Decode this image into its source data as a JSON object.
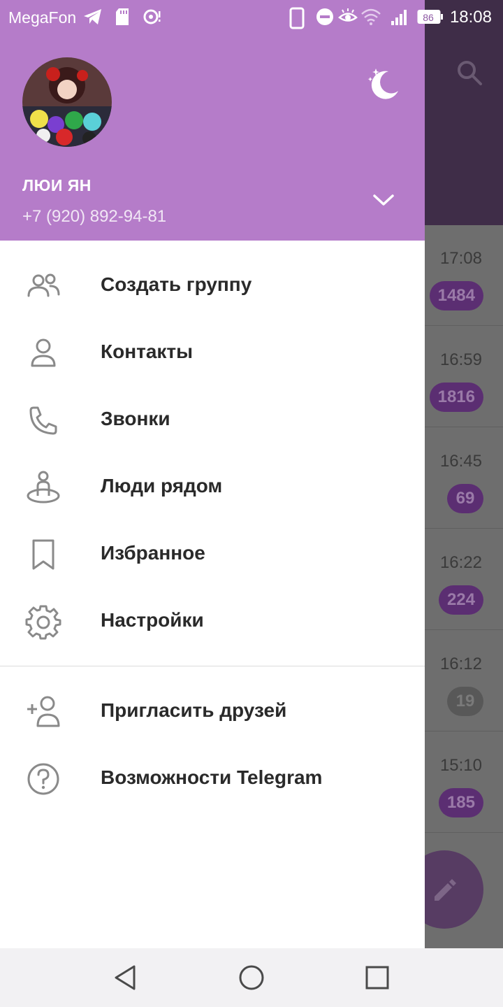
{
  "status_bar": {
    "carrier": "MegaFon",
    "battery": "86",
    "time": "18:08"
  },
  "drawer": {
    "user_name": "ЛЮИ ЯН",
    "user_phone": "+7 (920) 892-94-81",
    "menu": [
      {
        "label": "Создать группу",
        "icon": "group-icon"
      },
      {
        "label": "Контакты",
        "icon": "contact-icon"
      },
      {
        "label": "Звонки",
        "icon": "phone-icon"
      },
      {
        "label": "Люди рядом",
        "icon": "people-nearby-icon"
      },
      {
        "label": "Избранное",
        "icon": "bookmark-icon"
      },
      {
        "label": "Настройки",
        "icon": "gear-icon"
      }
    ],
    "menu_secondary": [
      {
        "label": "Пригласить друзей",
        "icon": "add-user-icon"
      },
      {
        "label": "Возможности Telegram",
        "icon": "help-icon"
      }
    ]
  },
  "chat_list": {
    "rows": [
      {
        "time": "17:08",
        "badge": "1484"
      },
      {
        "time": "16:59",
        "badge": "1816"
      },
      {
        "time": "16:45",
        "badge": "69"
      },
      {
        "time": "16:22",
        "badge": "224"
      },
      {
        "time": "16:12",
        "badge": "19"
      },
      {
        "time": "15:10",
        "badge": "185"
      }
    ]
  },
  "colors": {
    "header": "#b57cc9",
    "dimmed_header": "#3f2d48",
    "badge": "#5b2e72",
    "menu_text": "#2a2a2a",
    "icon_stroke": "#8a8a8a"
  }
}
